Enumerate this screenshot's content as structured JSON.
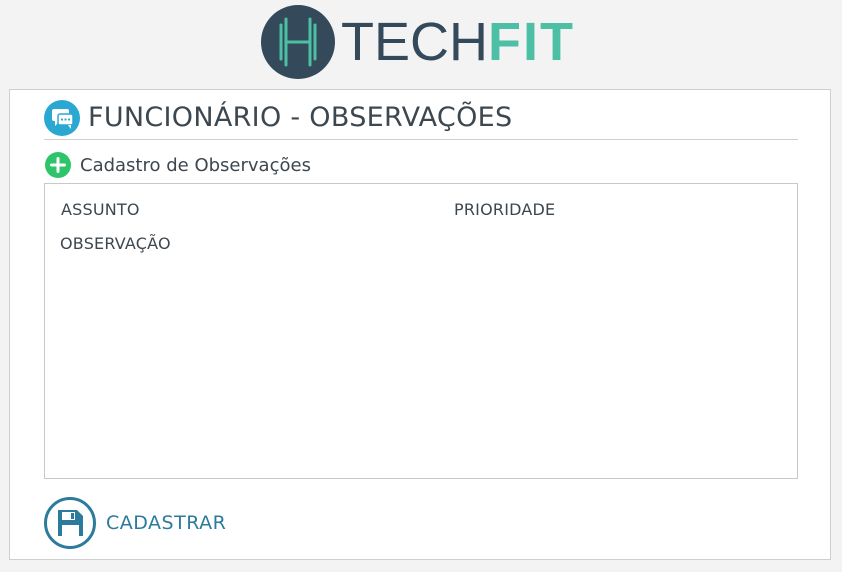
{
  "brand": {
    "logo_icon": "dumbbell-h-icon",
    "name_part1": "TECH",
    "name_part2": "FIT",
    "colors": {
      "primary": "#34495a",
      "accent": "#4dbfa4"
    }
  },
  "header": {
    "icon": "chat-bubbles-icon",
    "title": "FUNCIONÁRIO - OBSERVAÇÕES",
    "icon_color": "#2aa8d2"
  },
  "section": {
    "icon": "plus-circle-icon",
    "title": "Cadastro de Observações",
    "icon_color": "#2ec46a"
  },
  "form": {
    "subject_label": "ASSUNTO",
    "priority_label": "PRIORIDADE",
    "observation_label": "OBSERVAÇÃO"
  },
  "actions": {
    "save_icon": "floppy-disk-icon",
    "save_label": "CADASTRAR",
    "save_color": "#2c7b9c"
  }
}
